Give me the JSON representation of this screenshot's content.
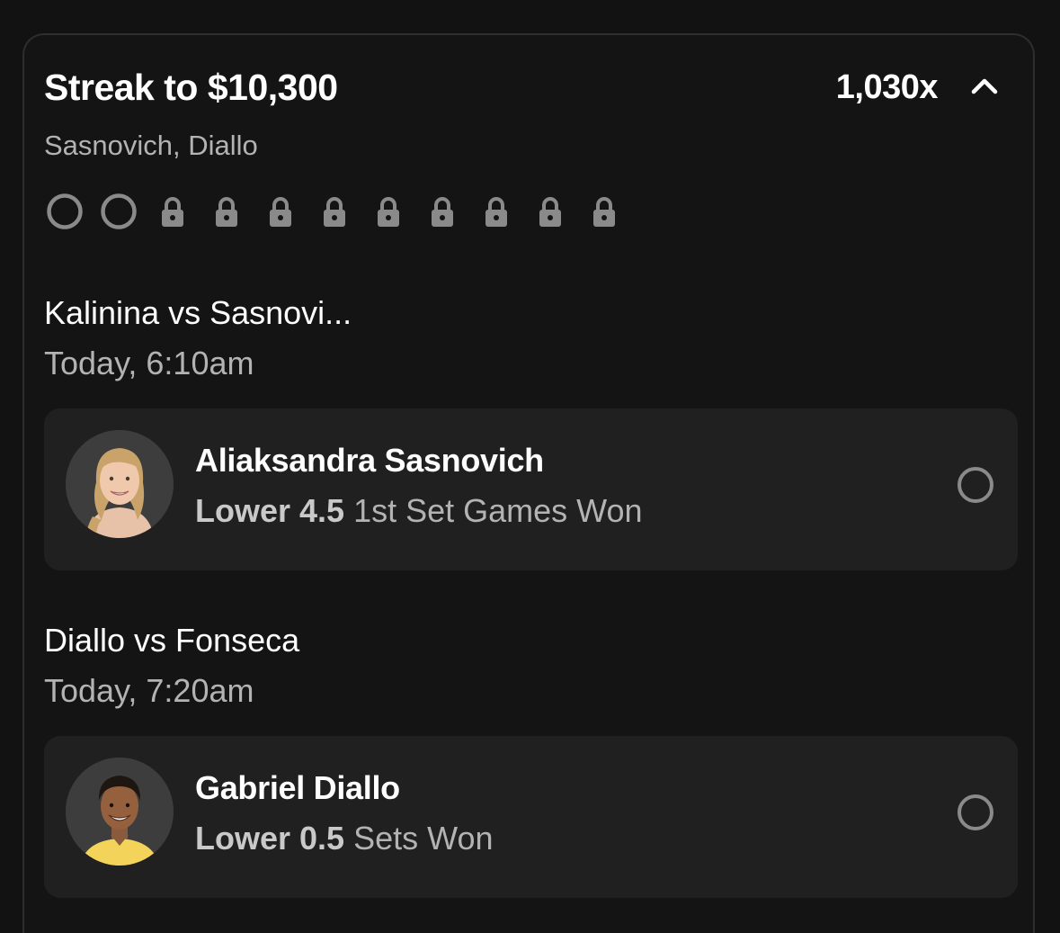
{
  "header": {
    "title": "Streak to $10,300",
    "multiplier": "1,030x",
    "players": "Sasnovich, Diallo"
  },
  "progress": {
    "open_slots": 2,
    "locked_slots": 9,
    "icons": [
      "empty-circle-icon",
      "lock-icon"
    ]
  },
  "colors": {
    "background": "#121212",
    "card": "#202020",
    "muted_text": "#b3b3b3",
    "icon_gray": "#8a8a8a"
  },
  "games": [
    {
      "matchup": "Kalinina vs Sasnovi...",
      "time": "Today, 6:10am",
      "pick": {
        "player": "Aliaksandra Sasnovich",
        "direction": "Lower 4.5",
        "stat": "1st Set Games Won"
      }
    },
    {
      "matchup": "Diallo vs Fonseca",
      "time": "Today, 7:20am",
      "pick": {
        "player": "Gabriel Diallo",
        "direction": "Lower 0.5",
        "stat": "Sets Won"
      }
    }
  ]
}
